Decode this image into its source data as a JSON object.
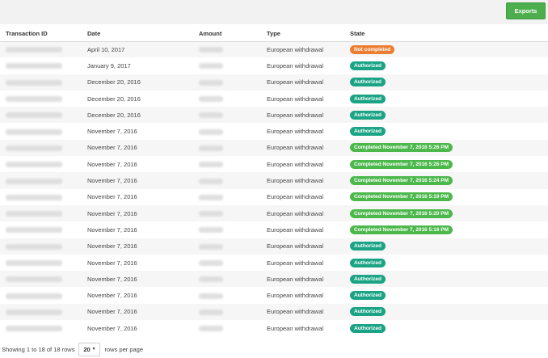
{
  "toolbar": {
    "export_label": "Exports",
    "export_color": "#4cae4c"
  },
  "table": {
    "headers": {
      "id": "Transaction ID",
      "date": "Date",
      "amount": "Amount",
      "type": "Type",
      "state": "State"
    },
    "rows": [
      {
        "date": "April 10, 2017",
        "type": "European withdrawal",
        "state": "Not completed",
        "state_color": "#ed7d31"
      },
      {
        "date": "January 9, 2017",
        "type": "European withdrawal",
        "state": "Authorized",
        "state_color": "#1aa384"
      },
      {
        "date": "December 20, 2016",
        "type": "European withdrawal",
        "state": "Authorized",
        "state_color": "#1aa384"
      },
      {
        "date": "December 20, 2016",
        "type": "European withdrawal",
        "state": "Authorized",
        "state_color": "#1aa384"
      },
      {
        "date": "December 20, 2016",
        "type": "European withdrawal",
        "state": "Authorized",
        "state_color": "#1aa384"
      },
      {
        "date": "November 7, 2016",
        "type": "European withdrawal",
        "state": "Authorized",
        "state_color": "#1aa384"
      },
      {
        "date": "November 7, 2016",
        "type": "European withdrawal",
        "state": "Completed November 7, 2016 5:26 PM",
        "state_color": "#4cb84c"
      },
      {
        "date": "November 7, 2016",
        "type": "European withdrawal",
        "state": "Completed November 7, 2016 5:26 PM",
        "state_color": "#4cb84c"
      },
      {
        "date": "November 7, 2016",
        "type": "European withdrawal",
        "state": "Completed November 7, 2016 5:24 PM",
        "state_color": "#4cb84c"
      },
      {
        "date": "November 7, 2016",
        "type": "European withdrawal",
        "state": "Completed November 7, 2016 5:19 PM",
        "state_color": "#4cb84c"
      },
      {
        "date": "November 7, 2016",
        "type": "European withdrawal",
        "state": "Completed November 7, 2016 5:20 PM",
        "state_color": "#4cb84c"
      },
      {
        "date": "November 7, 2016",
        "type": "European withdrawal",
        "state": "Completed November 7, 2016 5:16 PM",
        "state_color": "#4cb84c"
      },
      {
        "date": "November 7, 2016",
        "type": "European withdrawal",
        "state": "Authorized",
        "state_color": "#1aa384"
      },
      {
        "date": "November 7, 2016",
        "type": "European withdrawal",
        "state": "Authorized",
        "state_color": "#1aa384"
      },
      {
        "date": "November 7, 2016",
        "type": "European withdrawal",
        "state": "Authorized",
        "state_color": "#1aa384"
      },
      {
        "date": "November 7, 2016",
        "type": "European withdrawal",
        "state": "Authorized",
        "state_color": "#1aa384"
      },
      {
        "date": "November 7, 2016",
        "type": "European withdrawal",
        "state": "Authorized",
        "state_color": "#1aa384"
      },
      {
        "date": "November 7, 2016",
        "type": "European withdrawal",
        "state": "Authorized",
        "state_color": "#1aa384"
      }
    ]
  },
  "footer": {
    "showing_text": "Showing 1 to 18 of 18 rows",
    "page_size": "20",
    "rows_per_page_text": "rows per page"
  }
}
